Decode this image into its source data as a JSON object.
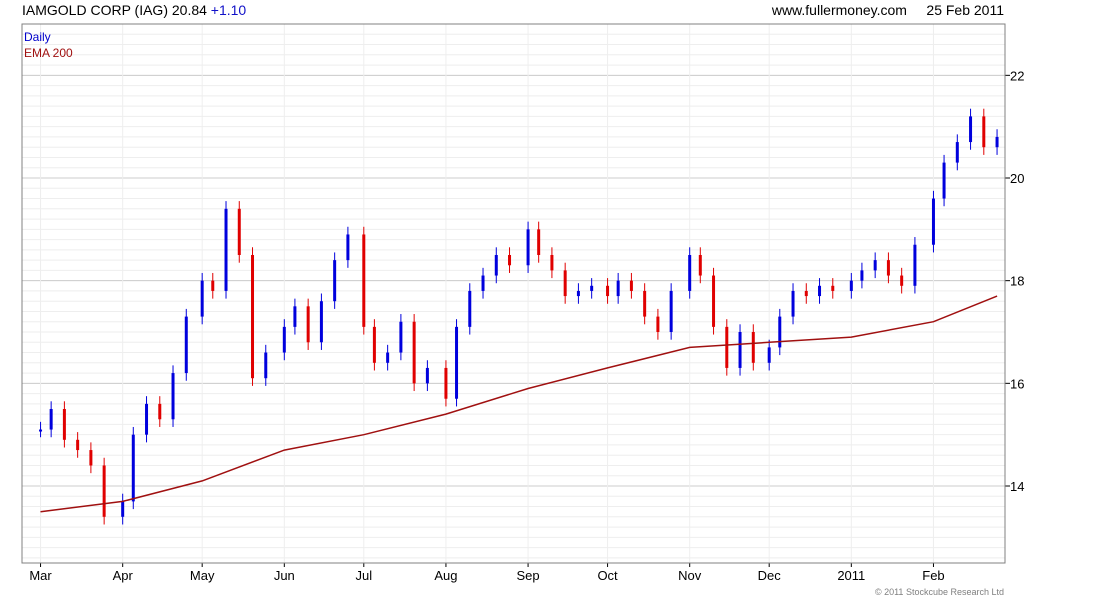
{
  "header": {
    "title": "IAMGOLD CORP (IAG) 20.84",
    "change": "+1.10",
    "site": "www.fullermoney.com",
    "date": "25 Feb 2011"
  },
  "legend": {
    "daily": "Daily",
    "ema": "EMA 200"
  },
  "copyright": "© 2011 Stockcube Research Ltd",
  "colors": {
    "up": "#0000dd",
    "down": "#e00000",
    "ema": "#a01010",
    "grid": "#cccccc",
    "minor_grid": "#eeeeee"
  },
  "chart_data": {
    "type": "line",
    "title": "IAMGOLD CORP (IAG) 20.84 +1.10",
    "x_tick_labels": [
      "Mar",
      "Apr",
      "May",
      "Jun",
      "Jul",
      "Aug",
      "Sep",
      "Oct",
      "Nov",
      "Dec",
      "2011",
      "Feb"
    ],
    "y_tick_labels": [
      "14",
      "16",
      "18",
      "20",
      "22"
    ],
    "ylim": [
      12.5,
      23
    ],
    "y_axis_side": "right",
    "grid": true,
    "legend_position": "top-left",
    "series": [
      {
        "name": "Daily",
        "style": "candlestick (close approximations per trading period)",
        "x": [
          "2010-03-01",
          "2010-03-05",
          "2010-03-10",
          "2010-03-15",
          "2010-03-20",
          "2010-03-25",
          "2010-04-01",
          "2010-04-05",
          "2010-04-10",
          "2010-04-15",
          "2010-04-20",
          "2010-04-25",
          "2010-05-01",
          "2010-05-05",
          "2010-05-10",
          "2010-05-15",
          "2010-05-20",
          "2010-05-25",
          "2010-06-01",
          "2010-06-05",
          "2010-06-10",
          "2010-06-15",
          "2010-06-20",
          "2010-06-25",
          "2010-07-01",
          "2010-07-05",
          "2010-07-10",
          "2010-07-15",
          "2010-07-20",
          "2010-07-25",
          "2010-08-01",
          "2010-08-05",
          "2010-08-10",
          "2010-08-15",
          "2010-08-20",
          "2010-08-25",
          "2010-09-01",
          "2010-09-05",
          "2010-09-10",
          "2010-09-15",
          "2010-09-20",
          "2010-09-25",
          "2010-10-01",
          "2010-10-05",
          "2010-10-10",
          "2010-10-15",
          "2010-10-20",
          "2010-10-25",
          "2010-11-01",
          "2010-11-05",
          "2010-11-10",
          "2010-11-15",
          "2010-11-20",
          "2010-11-25",
          "2010-12-01",
          "2010-12-05",
          "2010-12-10",
          "2010-12-15",
          "2010-12-20",
          "2010-12-25",
          "2011-01-01",
          "2011-01-05",
          "2011-01-10",
          "2011-01-15",
          "2011-01-20",
          "2011-01-25",
          "2011-02-01",
          "2011-02-05",
          "2011-02-10",
          "2011-02-15",
          "2011-02-20",
          "2011-02-25"
        ],
        "values": [
          15.1,
          15.5,
          14.9,
          14.7,
          14.4,
          13.4,
          13.7,
          15.0,
          15.6,
          15.3,
          16.2,
          17.3,
          18.0,
          17.8,
          19.4,
          18.5,
          16.1,
          16.6,
          17.1,
          17.5,
          16.8,
          17.6,
          18.4,
          18.9,
          17.1,
          16.4,
          16.6,
          17.2,
          16.0,
          16.3,
          15.7,
          17.1,
          17.8,
          18.1,
          18.5,
          18.3,
          19.0,
          18.5,
          18.2,
          17.7,
          17.8,
          17.9,
          17.7,
          18.0,
          17.8,
          17.3,
          17.0,
          17.8,
          18.5,
          18.1,
          17.1,
          16.3,
          17.0,
          16.4,
          16.7,
          17.3,
          17.8,
          17.7,
          17.9,
          17.8,
          18.0,
          18.2,
          18.4,
          18.1,
          17.9,
          18.7,
          19.6,
          20.3,
          20.7,
          21.2,
          20.6,
          20.8
        ]
      },
      {
        "name": "EMA 200",
        "x": [
          "2010-03-01",
          "2010-04-01",
          "2010-05-01",
          "2010-06-01",
          "2010-07-01",
          "2010-08-01",
          "2010-09-01",
          "2010-10-01",
          "2010-11-01",
          "2010-12-01",
          "2011-01-01",
          "2011-02-01",
          "2011-02-25"
        ],
        "values": [
          13.5,
          13.7,
          14.1,
          14.7,
          15.0,
          15.4,
          15.9,
          16.3,
          16.7,
          16.8,
          16.9,
          17.2,
          17.7
        ]
      }
    ]
  }
}
